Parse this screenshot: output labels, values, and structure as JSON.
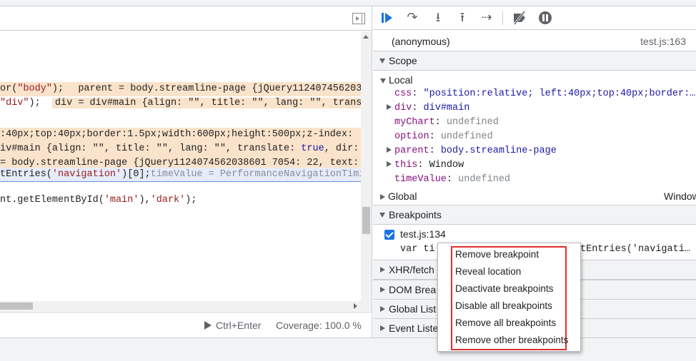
{
  "editor": {
    "lines": [
      {
        "pre": "or(",
        "str1": "\"body\"",
        "post": ");  ",
        "inline": "parent = body.streamline-page {jQuery1124074562038"
      },
      {
        "pre": "",
        "str1": "\"div\"",
        "post": ");  ",
        "inline": "div = div#main {align: \"\", title: \"\", lang: \"\", trans"
      },
      {
        "text": ":40px;top:40px;border:1.5px;width:600px;height:500px;z-index:"
      },
      {
        "text_a": "iv#main {align: \"\", title: \"\", lang: \"\", translate: ",
        "kw": "true",
        "text_b": ", dir:"
      },
      {
        "text_a": "= body.streamline-page {jQuery1124074562038601 7054: 22, text:"
      },
      {
        "pre": "tEntries(",
        "str1": "'navigation'",
        "post": ")[0];",
        "dimmed": "timeValue = PerformanceNavigationTimi"
      },
      {
        "pre": "nt.getElementById(",
        "str1": "'main'",
        "mid": "),",
        "str2": "'dark'",
        "post": ");"
      }
    ],
    "status": {
      "run_label": "Ctrl+Enter",
      "coverage_label": "Coverage: 100.0 %"
    }
  },
  "debugger": {
    "callframe": {
      "name": "(anonymous)",
      "location": "test.js:163"
    },
    "scope": {
      "title": "Scope",
      "local_label": "Local",
      "items": [
        {
          "key": "css",
          "sep": ": ",
          "value": "\"position:relative; left:40px;top:40px;border:…",
          "kind": "str",
          "expandable": false
        },
        {
          "key": "div",
          "sep": ": ",
          "value": "div#main",
          "kind": "obj",
          "expandable": true
        },
        {
          "key": "myChart",
          "sep": ": ",
          "value": "undefined",
          "kind": "undef",
          "expandable": false
        },
        {
          "key": "option",
          "sep": ": ",
          "value": "undefined",
          "kind": "undef",
          "expandable": false
        },
        {
          "key": "parent",
          "sep": ": ",
          "value": "body.streamline-page",
          "kind": "obj",
          "expandable": true
        },
        {
          "key": "this",
          "sep": ": ",
          "value": "Window",
          "kind": "plain",
          "expandable": true
        },
        {
          "key": "timeValue",
          "sep": ": ",
          "value": "undefined",
          "kind": "undef",
          "expandable": false
        }
      ],
      "global_label": "Global",
      "global_value": "Window"
    },
    "breakpoints": {
      "title": "Breakpoints",
      "item_location": "test.js:134",
      "item_checked": true,
      "item_code_left": "var ti",
      "item_code_right": "tEntries('navigati…"
    },
    "sections": [
      {
        "label": "XHR/fetch"
      },
      {
        "label": "DOM Brea"
      },
      {
        "label": "Global List"
      },
      {
        "label": "Event Liste"
      }
    ]
  },
  "context_menu": {
    "items": [
      "Remove breakpoint",
      "Reveal location",
      "Deactivate breakpoints",
      "Disable all breakpoints",
      "Remove all breakpoints",
      "Remove other breakpoints"
    ],
    "highlight_color": "#e0302f"
  },
  "icons": {
    "resume": "resume-icon",
    "step_over": "step-over-icon",
    "step_into": "step-into-icon",
    "step_out": "step-out-icon",
    "step": "step-icon",
    "deactivate": "deactivate-breakpoints-icon",
    "pause_exceptions": "pause-on-exceptions-icon",
    "toggle_panel": "toggle-debugger-panel-icon"
  },
  "colors": {
    "accent": "#1a73e8",
    "inline_value_bg": "#fae3cb",
    "paused_line_bg": "#e6ecfa"
  }
}
